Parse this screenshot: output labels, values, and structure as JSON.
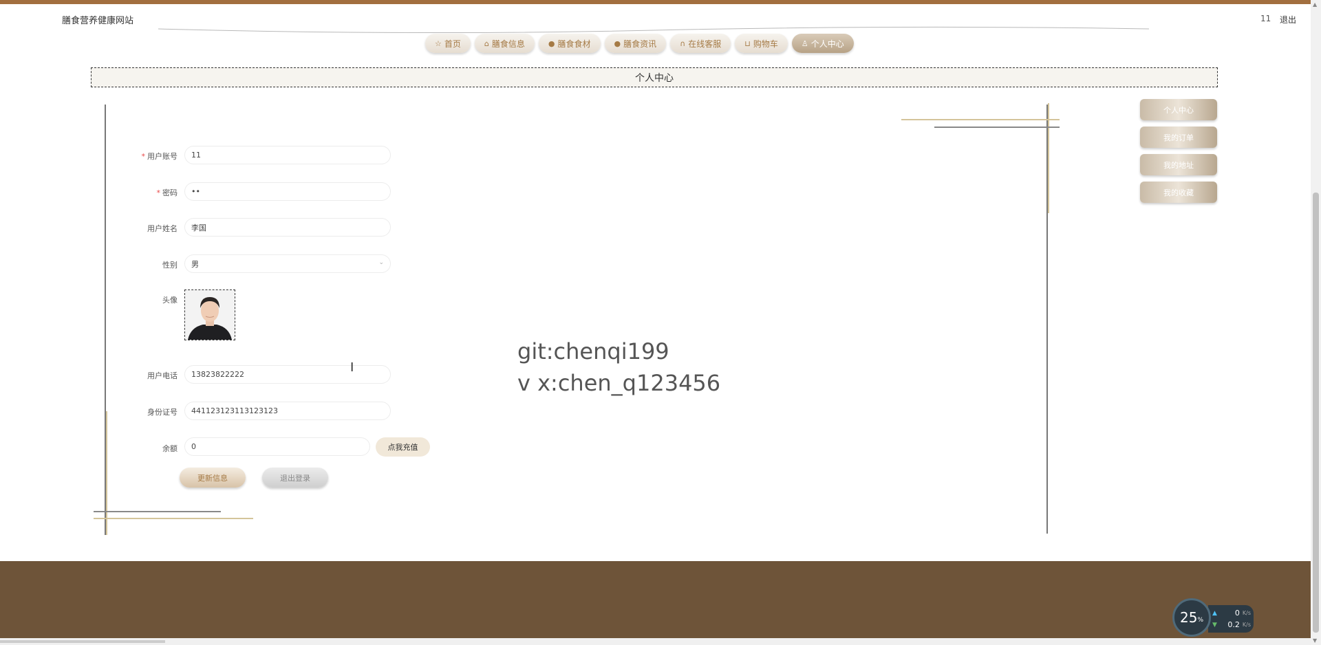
{
  "header": {
    "site_title": "膳食营养健康网站",
    "username": "11",
    "logout": "退出"
  },
  "nav": {
    "items": [
      {
        "label": "首页",
        "icon": "star-icon"
      },
      {
        "label": "膳食信息",
        "icon": "bag-icon"
      },
      {
        "label": "膳食食材",
        "icon": "info-icon"
      },
      {
        "label": "膳食资讯",
        "icon": "question-icon"
      },
      {
        "label": "在线客服",
        "icon": "headset-icon"
      },
      {
        "label": "购物车",
        "icon": "cart-icon"
      },
      {
        "label": "个人中心",
        "icon": "user-icon"
      }
    ],
    "active": "个人中心"
  },
  "section_title": "个人中心",
  "form": {
    "account": {
      "label": "用户账号",
      "value": "11"
    },
    "password": {
      "label": "密码",
      "value": "••"
    },
    "name": {
      "label": "用户姓名",
      "value": "李国"
    },
    "gender": {
      "label": "性别",
      "value": "男"
    },
    "avatar": {
      "label": "头像"
    },
    "phone": {
      "label": "用户电话",
      "value": "13823822222"
    },
    "id_card": {
      "label": "身份证号",
      "value": "441123123113123123"
    },
    "balance": {
      "label": "余额",
      "value": "0",
      "recharge": "点我充值"
    },
    "update_button": "更新信息",
    "logout_button": "退出登录"
  },
  "side_menu": [
    "个人中心",
    "我的订单",
    "我的地址",
    "我的收藏"
  ],
  "watermark": {
    "line1": "git:chenqi199",
    "line2": "v x:chen_q123456"
  },
  "speed_widget": {
    "percent": "25",
    "percent_unit": "%",
    "up": "0",
    "down": "0.2",
    "unit": "K/s"
  },
  "colors": {
    "top_strip": "#a26f3f",
    "footer": "#6e5439",
    "accent_gold": "#d4c49a",
    "nav_text": "#a57a45"
  }
}
